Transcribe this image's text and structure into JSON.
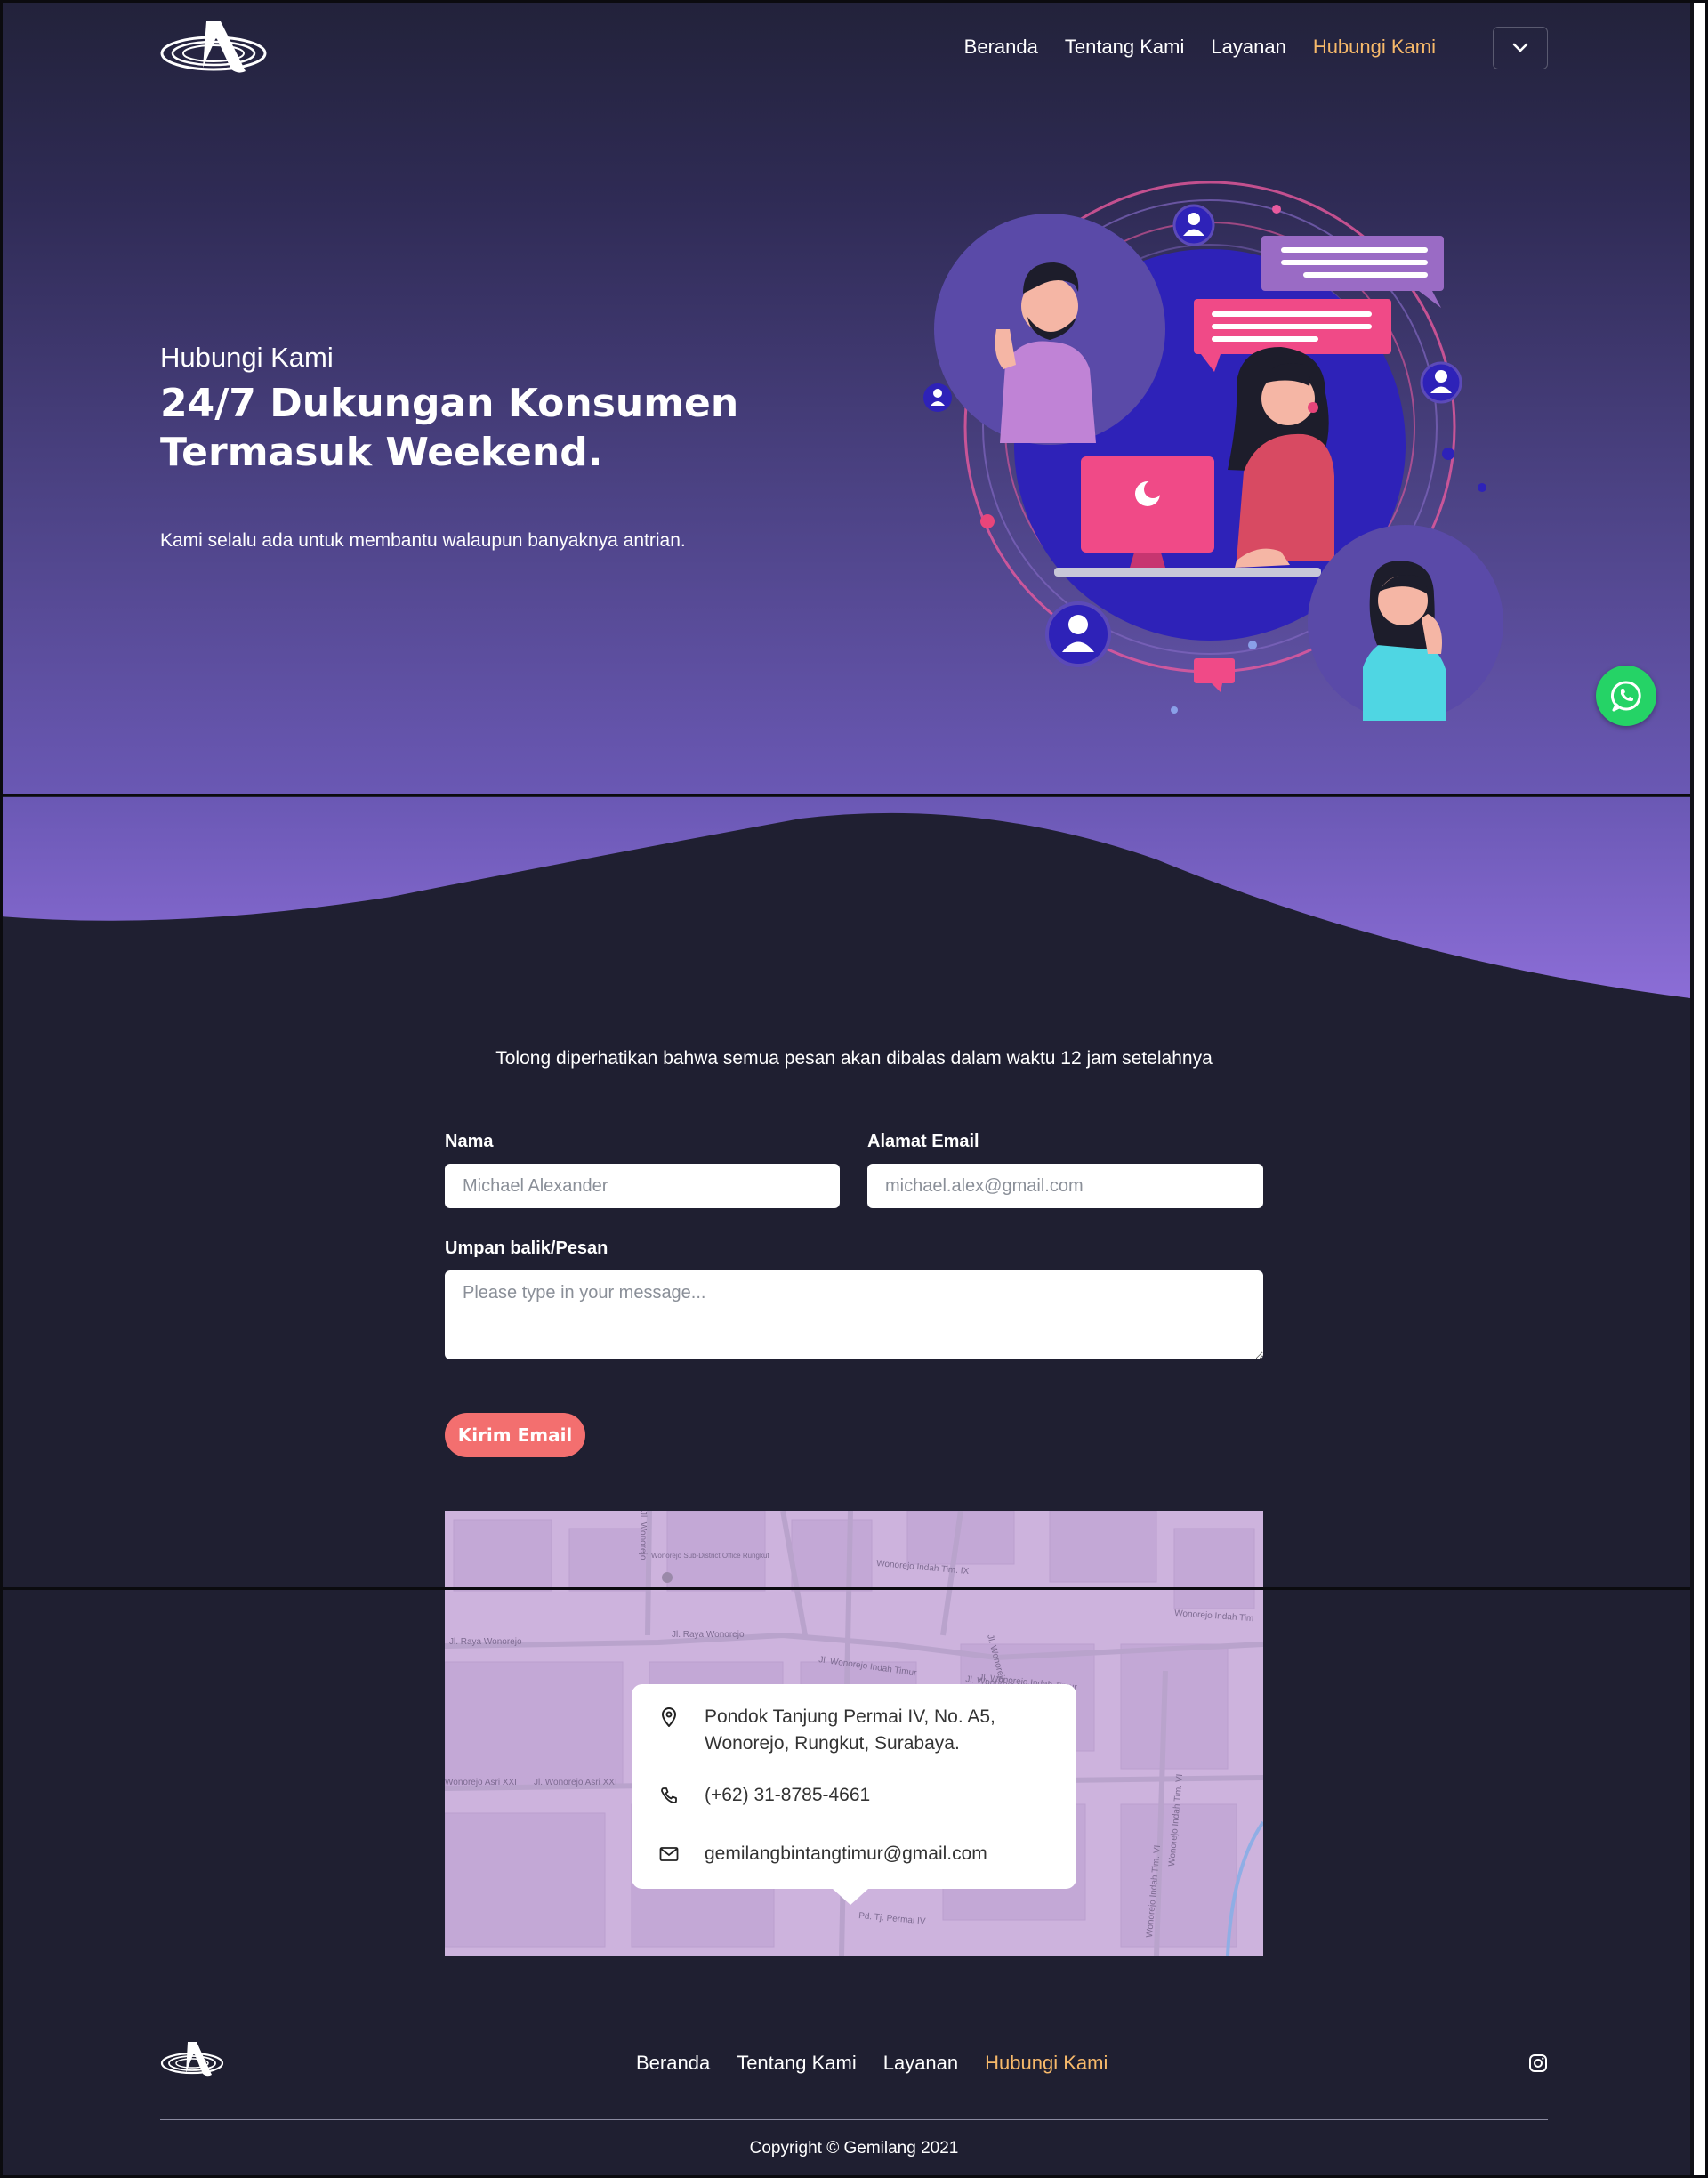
{
  "nav": {
    "items": [
      {
        "label": "Beranda",
        "active": false
      },
      {
        "label": "Tentang Kami",
        "active": false
      },
      {
        "label": "Layanan",
        "active": false
      },
      {
        "label": "Hubungi Kami",
        "active": true
      }
    ],
    "toggle_icon": "chevron-down-icon"
  },
  "hero": {
    "subtitle": "Hubungi Kami",
    "title": "24/7 Dukungan Konsumen Termasuk Weekend.",
    "description": "Kami selalu ada untuk membantu walaupun banyaknya antrian.",
    "illustration_icon": "customer-support-illustration"
  },
  "whatsapp": {
    "icon": "whatsapp-icon",
    "color": "#25d366"
  },
  "contact": {
    "notice": "Tolong diperhatikan bahwa semua pesan akan dibalas dalam waktu 12 jam setelahnya",
    "name_label": "Nama",
    "name_placeholder": "Michael Alexander",
    "email_label": "Alamat Email",
    "email_placeholder": "michael.alex@gmail.com",
    "message_label": "Umpan balik/Pesan",
    "message_placeholder": "Please type in your message...",
    "submit_label": "Kirim Email"
  },
  "map": {
    "streets": [
      "Jl. Raya Wonorejo",
      "Jl. Raya Wonorejo",
      "Jl. Wonorejo Indah Timur",
      "Wonorejo Indah Tim. IX",
      "Jl. Wonorejo Indah Timur",
      "Wonorejo Indah Tim",
      "Jl. Wonorejo Indah",
      "Jl. Wonorejo Indah Tim. III",
      "Wonorejo Indah Tim. VI",
      "Wonorejo Indah Tim. VI",
      "Wonorejo Asri XXI",
      "Jl. Wonorejo Asri XXI",
      "Pd. Tj. Permai IV",
      "Jl. Wonorejo",
      "Wonorejo Sub-District Office Rungkut"
    ]
  },
  "info": {
    "address_line1": "Pondok Tanjung Permai IV, No. A5,",
    "address_line2": "Wonorejo, Rungkut, Surabaya.",
    "phone": "(+62) 31-8785-4661",
    "email": "gemilangbintangtimur@gmail.com",
    "icons": [
      "map-pin-icon",
      "phone-icon",
      "mail-icon"
    ]
  },
  "footer": {
    "nav": [
      {
        "label": "Beranda",
        "active": false
      },
      {
        "label": "Tentang Kami",
        "active": false
      },
      {
        "label": "Layanan",
        "active": false
      },
      {
        "label": "Hubungi Kami",
        "active": true
      }
    ],
    "social_icon": "instagram-icon",
    "copyright": "Copyright © Gemilang 2021"
  },
  "colors": {
    "background": "#1f1f31",
    "accent": "#f7b96a",
    "button": "#f36f6f",
    "purple": "#6a58b4"
  }
}
